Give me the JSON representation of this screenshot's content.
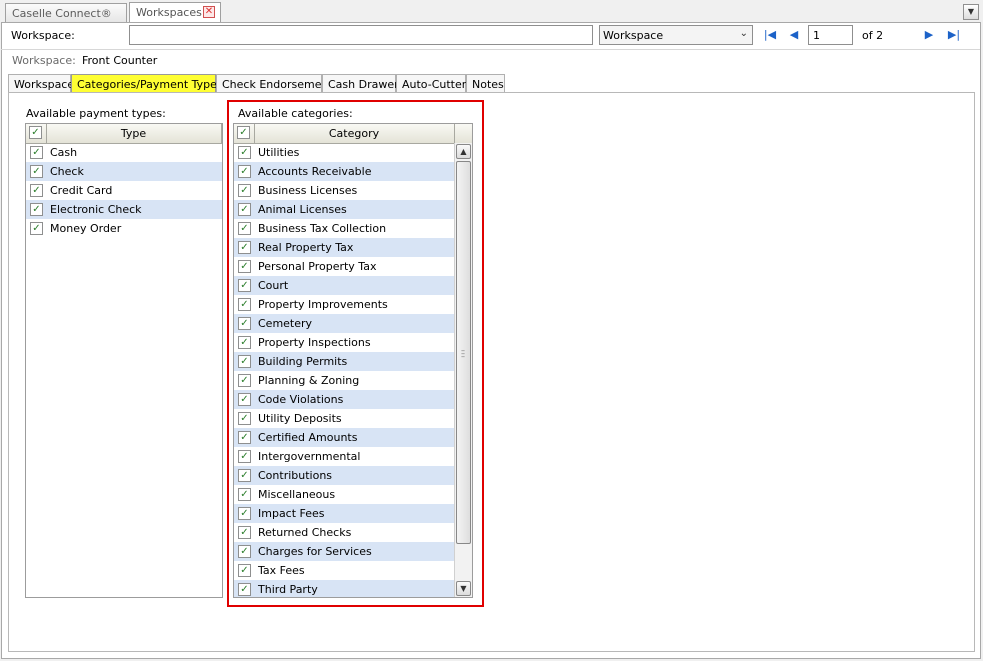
{
  "doc_tabs": [
    {
      "label": "Caselle Connect®"
    },
    {
      "label": "Workspaces"
    }
  ],
  "toolbar": {
    "workspace_label": "Workspace:",
    "workspace_input_value": "",
    "workspace_select_value": "Workspace",
    "page_value": "1",
    "page_of": "of 2"
  },
  "info": {
    "workspace_label": "Workspace:",
    "workspace_value": "Front Counter"
  },
  "section_tabs": [
    {
      "label": "Workspace"
    },
    {
      "label": "Categories/Payment Types"
    },
    {
      "label": "Check Endorsement"
    },
    {
      "label": "Cash Drawer"
    },
    {
      "label": "Auto-Cutter"
    },
    {
      "label": "Notes"
    }
  ],
  "payment_types": {
    "label": "Available payment types:",
    "column": "Type",
    "rows": [
      {
        "name": "Cash",
        "checked": true
      },
      {
        "name": "Check",
        "checked": true
      },
      {
        "name": "Credit Card",
        "checked": true
      },
      {
        "name": "Electronic Check",
        "checked": true
      },
      {
        "name": "Money Order",
        "checked": true
      }
    ]
  },
  "categories": {
    "label": "Available categories:",
    "column": "Category",
    "rows": [
      {
        "name": "Utilities",
        "checked": true
      },
      {
        "name": "Accounts Receivable",
        "checked": true
      },
      {
        "name": "Business Licenses",
        "checked": true
      },
      {
        "name": "Animal Licenses",
        "checked": true
      },
      {
        "name": "Business Tax Collection",
        "checked": true
      },
      {
        "name": "Real Property Tax",
        "checked": true
      },
      {
        "name": "Personal Property Tax",
        "checked": true
      },
      {
        "name": "Court",
        "checked": true
      },
      {
        "name": "Property Improvements",
        "checked": true
      },
      {
        "name": "Cemetery",
        "checked": true
      },
      {
        "name": "Property Inspections",
        "checked": true
      },
      {
        "name": "Building Permits",
        "checked": true
      },
      {
        "name": "Planning & Zoning",
        "checked": true
      },
      {
        "name": "Code Violations",
        "checked": true
      },
      {
        "name": "Utility Deposits",
        "checked": true
      },
      {
        "name": "Certified Amounts",
        "checked": true
      },
      {
        "name": "Intergovernmental",
        "checked": true
      },
      {
        "name": "Contributions",
        "checked": true
      },
      {
        "name": "Miscellaneous",
        "checked": true
      },
      {
        "name": "Impact Fees",
        "checked": true
      },
      {
        "name": "Returned Checks",
        "checked": true
      },
      {
        "name": "Charges for Services",
        "checked": true
      },
      {
        "name": "Tax Fees",
        "checked": true
      },
      {
        "name": "Third Party",
        "checked": true
      }
    ]
  },
  "icons": {
    "check": "✓",
    "first": "|◀",
    "prev": "◀",
    "next": "▶",
    "last": "▶|",
    "close": "✕",
    "dropdown": "▼"
  },
  "colors": {
    "active_tab": "#ffff33",
    "alt_row": "#d8e4f5",
    "highlight_border": "#e00000",
    "nav_icon": "#1c62c8"
  }
}
